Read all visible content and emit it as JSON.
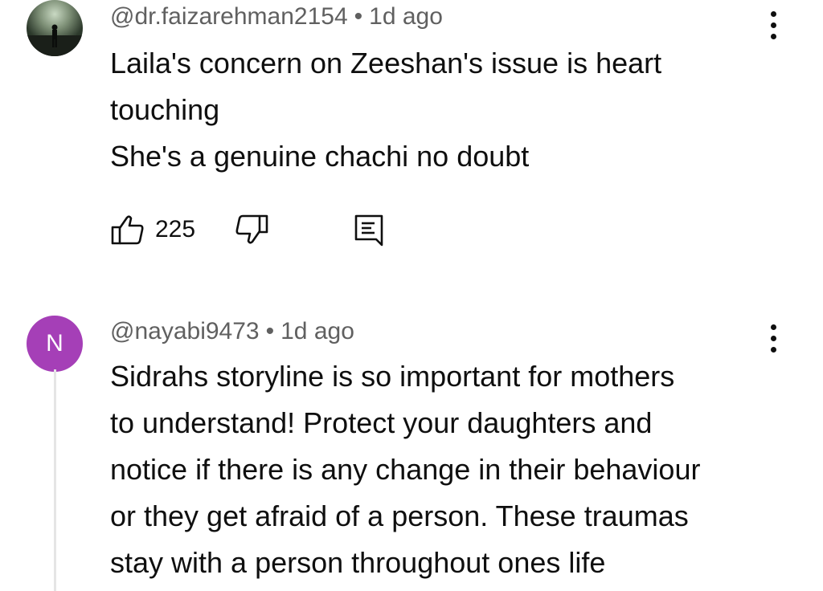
{
  "comments": [
    {
      "author": "@dr.faizarehman2154",
      "separator": "•",
      "time": "1d ago",
      "lines": [
        "Laila's concern on Zeeshan's issue is heart",
        "touching",
        "She's a genuine chachi no doubt"
      ],
      "likes": "225",
      "avatar_icon": "profile-photo",
      "like_icon": "thumbs-up-icon",
      "dislike_icon": "thumbs-down-icon",
      "reply_icon": "reply-comment-icon",
      "menu_icon": "more-vert-icon"
    },
    {
      "author": "@nayabi9473",
      "separator": "•",
      "time": "1d ago",
      "avatar_letter": "N",
      "avatar_color": "#a53fb7",
      "lines": [
        "Sidrahs storyline is so important for mothers",
        "to understand! Protect your daughters and",
        "notice if there is any change in their behaviour",
        "or they get afraid of a person. These traumas",
        "stay with a person throughout ones life"
      ],
      "menu_icon": "more-vert-icon"
    }
  ]
}
